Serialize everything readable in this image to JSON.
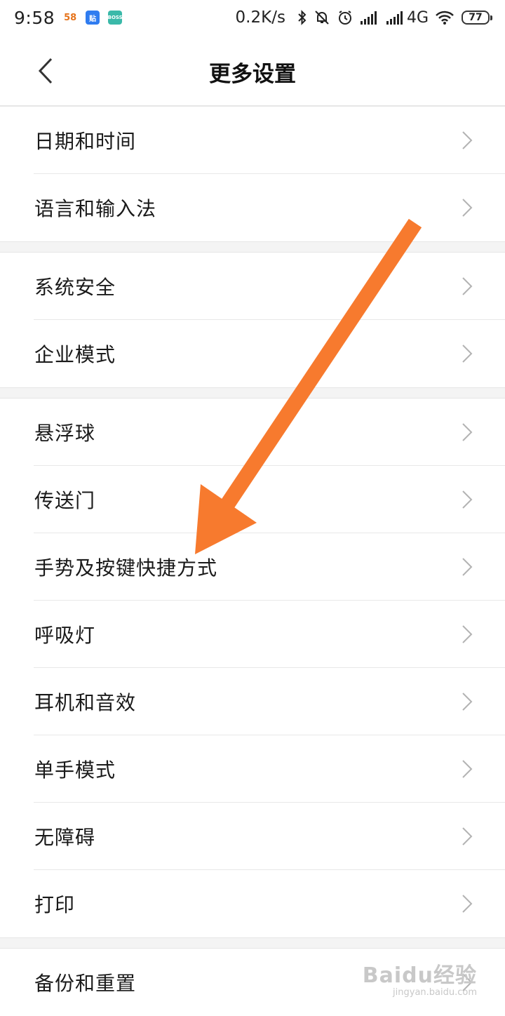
{
  "status_bar": {
    "time": "9:58",
    "app_icons": [
      {
        "name": "58-app-icon",
        "text": "58"
      },
      {
        "name": "tieba-app-icon",
        "text": "贴"
      },
      {
        "name": "boss-app-icon",
        "text": "BOSS"
      }
    ],
    "net_speed": "0.2K/s",
    "network_type": "4G",
    "battery": "77"
  },
  "header": {
    "title": "更多设置"
  },
  "groups": [
    {
      "items": [
        "日期和时间",
        "语言和输入法"
      ]
    },
    {
      "items": [
        "系统安全",
        "企业模式"
      ]
    },
    {
      "items": [
        "悬浮球",
        "传送门",
        "手势及按键快捷方式",
        "呼吸灯",
        "耳机和音效",
        "单手模式",
        "无障碍",
        "打印"
      ]
    },
    {
      "items": [
        "备份和重置"
      ]
    }
  ],
  "annotation": {
    "arrow_color": "#f77a2e"
  },
  "watermark": {
    "main": "Baidu经验",
    "sub": "jingyan.baidu.com"
  }
}
